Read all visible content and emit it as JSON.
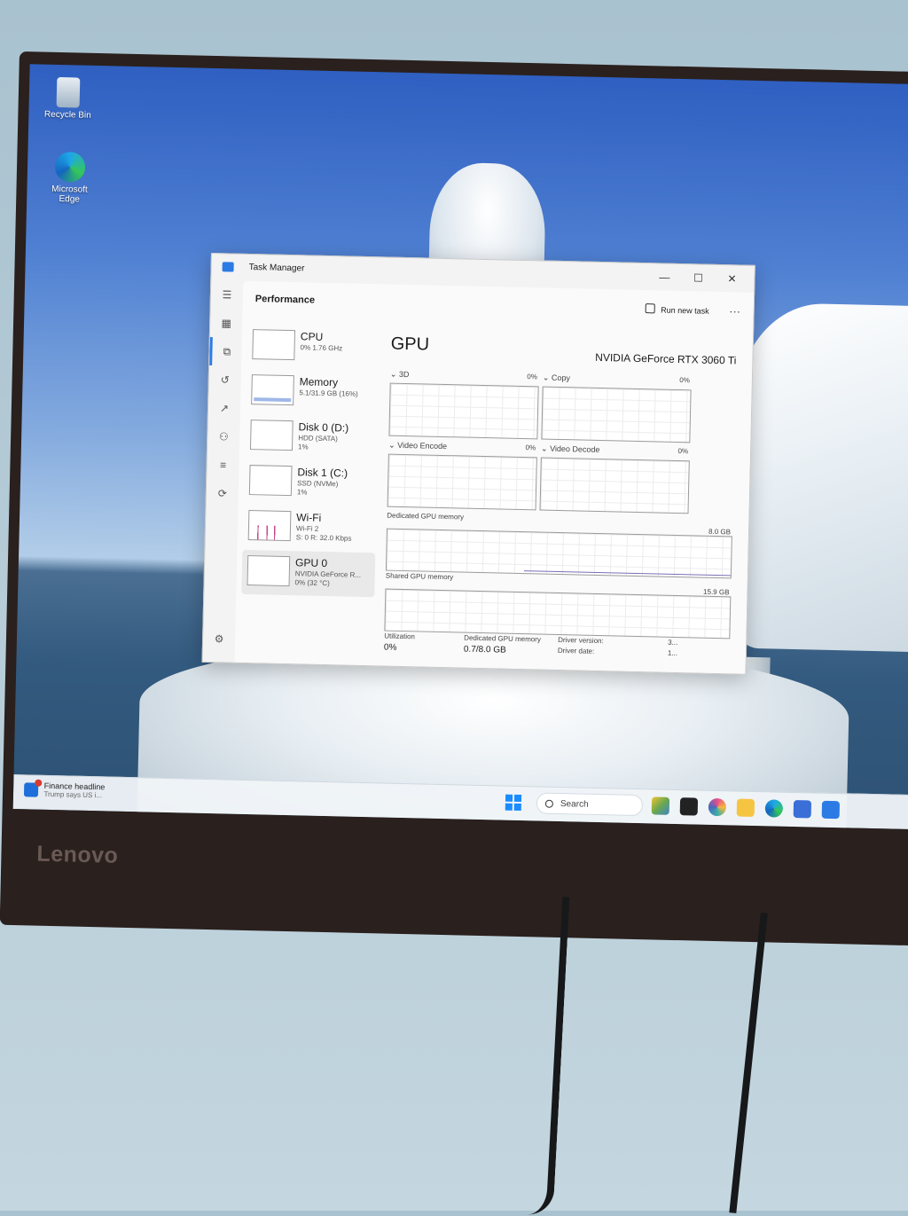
{
  "desktop": {
    "icons": [
      {
        "label": "Recycle Bin",
        "icon": "recycle-bin-icon"
      },
      {
        "label": "Microsoft Edge",
        "icon": "edge-icon"
      }
    ]
  },
  "taskbar": {
    "news_title": "Finance headline",
    "news_sub": "Trump says US i...",
    "search_placeholder": "Search"
  },
  "monitor": {
    "brand": "Lenovo"
  },
  "task_manager": {
    "title": "Task Manager",
    "section": "Performance",
    "run_new_task": "Run new task",
    "more": "...",
    "devices": [
      {
        "name": "CPU",
        "line2": "0% 1.76 GHz",
        "line3": ""
      },
      {
        "name": "Memory",
        "line2": "5.1/31.9 GB (16%)",
        "line3": ""
      },
      {
        "name": "Disk 0 (D:)",
        "line2": "HDD (SATA)",
        "line3": "1%"
      },
      {
        "name": "Disk 1 (C:)",
        "line2": "SSD (NVMe)",
        "line3": "1%"
      },
      {
        "name": "Wi-Fi",
        "line2": "Wi-Fi 2",
        "line3": "S: 0 R: 32.0 Kbps"
      },
      {
        "name": "GPU 0",
        "line2": "NVIDIA GeForce R...",
        "line3": "0% (32 °C)"
      }
    ],
    "gpu": {
      "heading": "GPU",
      "model": "NVIDIA GeForce RTX 3060 Ti",
      "engines": [
        {
          "label": "3D",
          "pct": "0%"
        },
        {
          "label": "Copy",
          "pct": "0%"
        },
        {
          "label": "Video Encode",
          "pct": "0%"
        },
        {
          "label": "Video Decode",
          "pct": "0%"
        }
      ],
      "dedicated_label": "Dedicated GPU memory",
      "dedicated_max": "8.0 GB",
      "shared_label": "Shared GPU memory",
      "shared_max": "15.9 GB",
      "stats": {
        "utilization_label": "Utilization",
        "utilization_value": "0%",
        "dedicated_label": "Dedicated GPU memory",
        "dedicated_value": "0.7/8.0 GB",
        "driver_version_label": "Driver version:",
        "driver_version_value": "3...",
        "driver_date_label": "Driver date:",
        "driver_date_value": "1..."
      }
    }
  }
}
